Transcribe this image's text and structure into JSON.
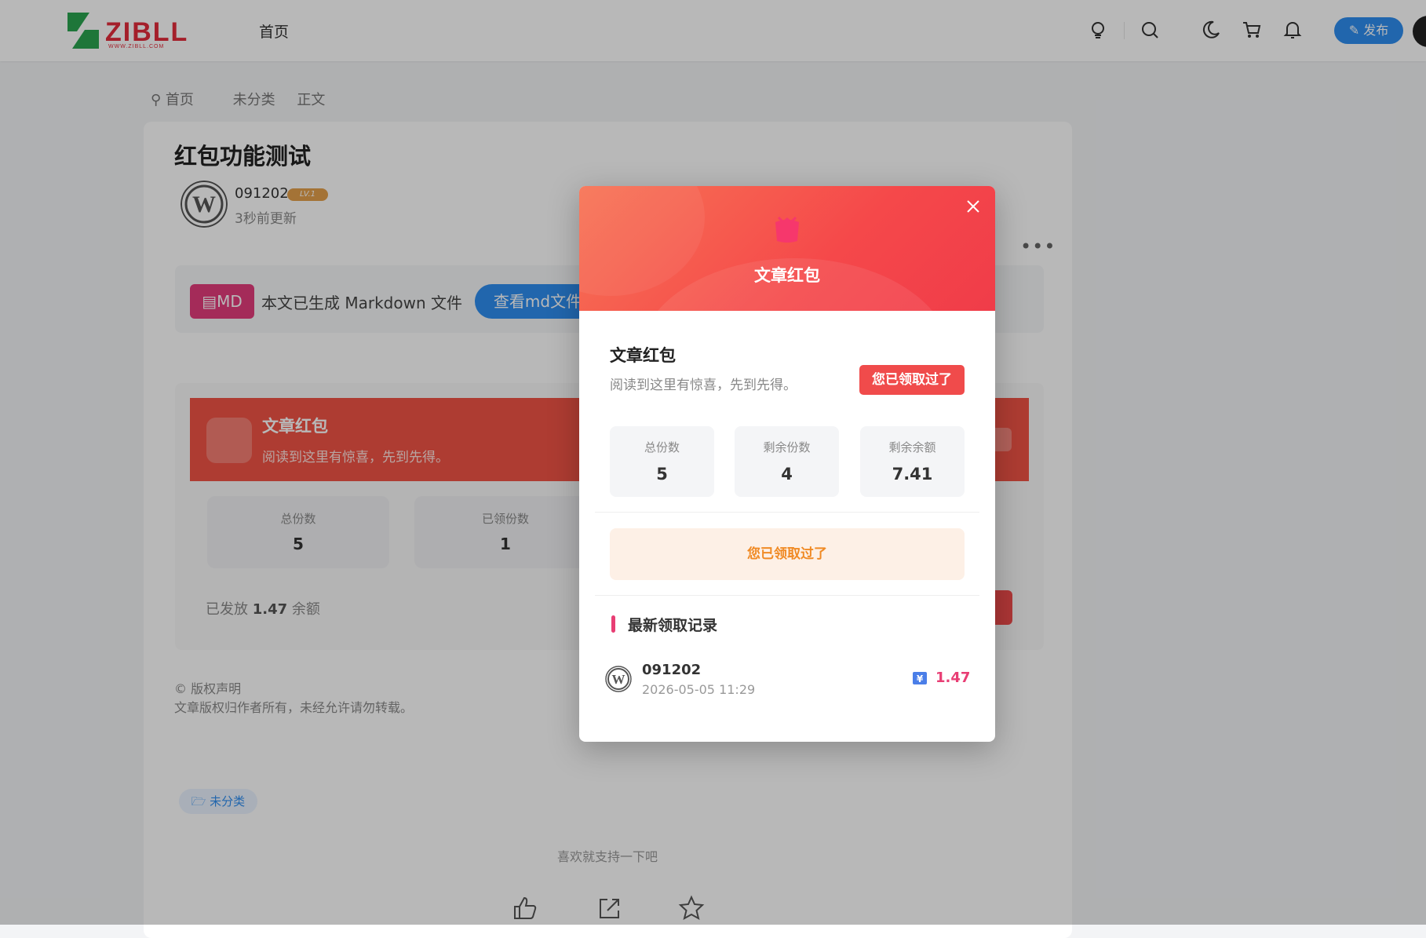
{
  "header": {
    "logo_text": "ZIBLL",
    "logo_sub": "WWW.ZIBLL.COM",
    "nav_home": "首页",
    "icons": [
      "lightbulb-icon",
      "search-icon",
      "moon-icon",
      "cart-icon",
      "bell-icon"
    ],
    "publish_label": "发布"
  },
  "breadcrumb": {
    "home": "首页",
    "category": "未分类",
    "current": "正文"
  },
  "article": {
    "title": "红包功能测试",
    "author": "091202",
    "level": "LV.1",
    "updated": "3秒前更新",
    "md_badge": "MD",
    "md_text": "本文已生成 Markdown 文件",
    "md_button": "查看md文件",
    "redpacket": {
      "title": "文章红包",
      "subtitle": "阅读到这里有惊喜，先到先得。",
      "stats": [
        {
          "label": "总份数",
          "value": "5"
        },
        {
          "label": "已领份数",
          "value": "1"
        }
      ],
      "issued_prefix": "已发放",
      "issued_amount": "1.47",
      "issued_suffix": "余额"
    },
    "copyright_heading": "© 版权声明",
    "copyright_text": "文章版权归作者所有，未经允许请勿转载。",
    "tag": "未分类",
    "support_text": "喜欢就支持一下吧"
  },
  "modal": {
    "header_title": "文章红包",
    "name": "文章红包",
    "desc": "阅读到这里有惊喜，先到先得。",
    "claimed_button": "您已领取过了",
    "stats": [
      {
        "label": "总份数",
        "value": "5"
      },
      {
        "label": "剩余份数",
        "value": "4"
      },
      {
        "label": "剩余余额",
        "value": "7.41"
      }
    ],
    "claimed_bar": "您已领取过了",
    "records_title": "最新领取记录",
    "records": [
      {
        "user": "091202",
        "time": "2026-05-05 11:29",
        "amount": "1.47"
      }
    ]
  },
  "colors": {
    "accent_blue": "#2f8ef0",
    "red": "#f04b4b",
    "pink": "#e83e74",
    "orange": "#f08a24"
  }
}
